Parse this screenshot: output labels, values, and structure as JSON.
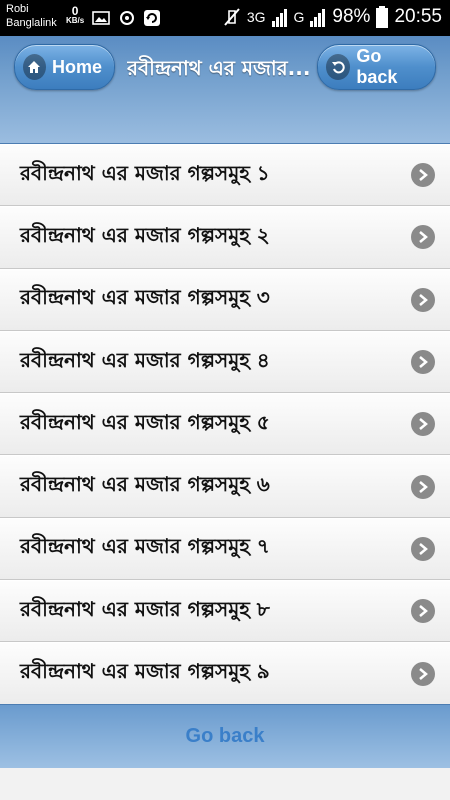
{
  "status_bar": {
    "carrier_line1": "Robi",
    "carrier_line2": "Banglalink",
    "net_speed_value": "0",
    "net_speed_unit": "KB/s",
    "network_3g": "3G",
    "network_g": "G",
    "battery": "98%",
    "time": "20:55"
  },
  "header": {
    "home_label": "Home",
    "title": "রবীন্দ্রনাথ এর মজার...",
    "back_label": "Go back",
    "accent_color": "#4f8fcc"
  },
  "list": {
    "items": [
      {
        "label": "রবীন্দ্রনাথ এর মজার গল্পসমুহ ১"
      },
      {
        "label": "রবীন্দ্রনাথ এর মজার গল্পসমুহ ২"
      },
      {
        "label": "রবীন্দ্রনাথ এর মজার গল্পসমুহ ৩"
      },
      {
        "label": "রবীন্দ্রনাথ এর মজার গল্পসমুহ ৪"
      },
      {
        "label": "রবীন্দ্রনাথ এর মজার গল্পসমুহ ৫"
      },
      {
        "label": "রবীন্দ্রনাথ এর মজার গল্পসমুহ ৬"
      },
      {
        "label": "রবীন্দ্রনাথ এর মজার গল্পসমুহ ৭"
      },
      {
        "label": "রবীন্দ্রনাথ এর মজার গল্পসমুহ ৮"
      },
      {
        "label": "রবীন্দ্রনাথ এর মজার গল্পসমুহ ৯"
      }
    ]
  },
  "footer": {
    "back_link_label": "Go back"
  }
}
